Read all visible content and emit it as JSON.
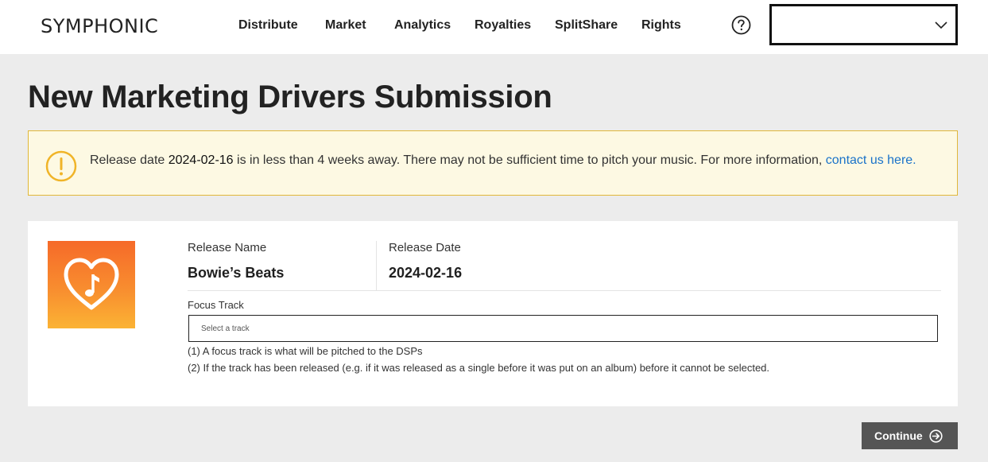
{
  "header": {
    "logo": "SYMPHONIC",
    "nav": [
      "Distribute",
      "Market",
      "Analytics",
      "Royalties",
      "SplitShare",
      "Rights"
    ],
    "account_value": ""
  },
  "page": {
    "title": "New Marketing Drivers Submission"
  },
  "alert": {
    "prefix": "Release date ",
    "date": "2024-02-16",
    "message": " is in less than 4 weeks away. There may not be sufficient time to pitch your music. For more information, ",
    "link": "contact us here.",
    "color": "#e0b73a"
  },
  "release": {
    "name_label": "Release Name",
    "name_value": "Bowie’s Beats",
    "date_label": "Release Date",
    "date_value": "2024-02-16",
    "cover_icon": "heart-music-note-icon"
  },
  "focus": {
    "label": "Focus Track",
    "placeholder": "Select a track",
    "notes": [
      "(1) A focus track is what will be pitched to the DSPs",
      "(2) If the track has been released (e.g. if it was released as a single before it was put on an album) before it cannot be selected."
    ]
  },
  "actions": {
    "continue": "Continue"
  }
}
